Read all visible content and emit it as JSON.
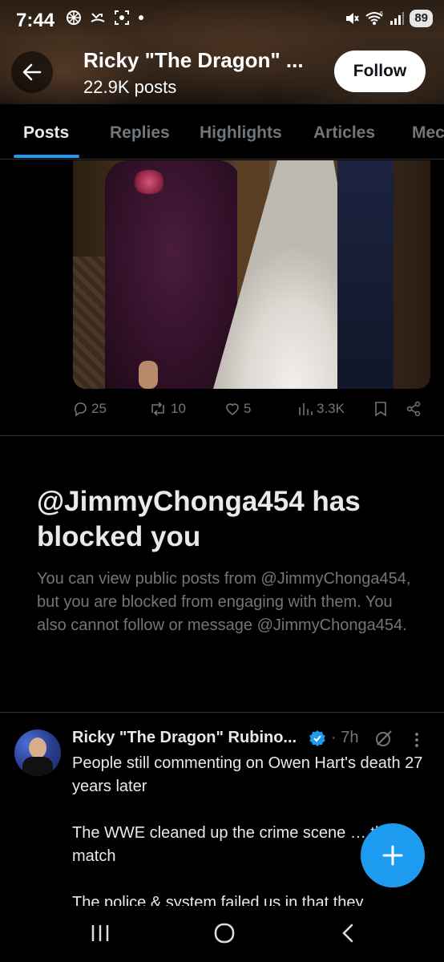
{
  "status_bar": {
    "time": "7:44",
    "battery": "89",
    "network": "6"
  },
  "header": {
    "profile_name": "Ricky \"The Dragon\" ...",
    "post_count": "22.9K posts",
    "follow_label": "Follow"
  },
  "tabs": [
    {
      "label": "Posts",
      "active": true
    },
    {
      "label": "Replies",
      "active": false
    },
    {
      "label": "Highlights",
      "active": false
    },
    {
      "label": "Articles",
      "active": false
    },
    {
      "label": "Mec",
      "active": false
    }
  ],
  "media_post": {
    "replies": "25",
    "reposts": "10",
    "likes": "5",
    "views": "3.3K"
  },
  "blocked": {
    "title": "@JimmyChonga454 has blocked you",
    "body": "You can view public posts from @JimmyChonga454, but you are blocked from engaging with them. You also cannot follow or message @JimmyChonga454."
  },
  "post": {
    "author": "Ricky \"The Dragon\" Rubino...",
    "time": "· 7h",
    "paragraphs": [
      "People still commenting on Owen Hart's death 27 years later",
      "The WWE cleaned up the crime scene … the match",
      "The police & system failed us in that they"
    ]
  },
  "colors": {
    "accent": "#1d9bf0",
    "text": "#e7e9ea",
    "muted": "#71767b",
    "background": "#000000"
  }
}
